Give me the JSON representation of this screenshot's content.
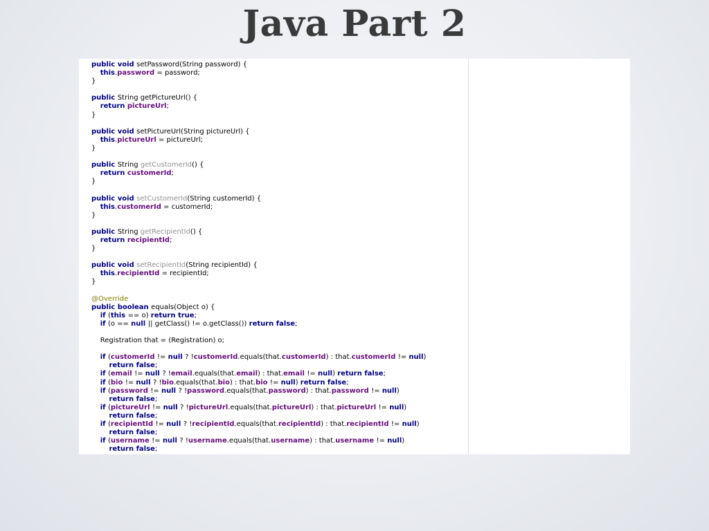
{
  "slide": {
    "title": "Java Part 2"
  },
  "code": {
    "lines": [
      [
        [
          "kw",
          "public void "
        ],
        [
          "plain",
          "setPassword(String password) {"
        ]
      ],
      [
        [
          "plain",
          "    "
        ],
        [
          "kw",
          "this"
        ],
        [
          "plain",
          "."
        ],
        [
          "fld",
          "password"
        ],
        [
          "plain",
          " = password;"
        ]
      ],
      [
        [
          "plain",
          "}"
        ]
      ],
      [],
      [
        [
          "kw",
          "public "
        ],
        [
          "plain",
          "String getPictureUrl() {"
        ]
      ],
      [
        [
          "plain",
          "    "
        ],
        [
          "kw",
          "return "
        ],
        [
          "fld",
          "pictureUrl"
        ],
        [
          "plain",
          ";"
        ]
      ],
      [
        [
          "plain",
          "}"
        ]
      ],
      [],
      [
        [
          "kw",
          "public void "
        ],
        [
          "plain",
          "setPictureUrl(String pictureUrl) {"
        ]
      ],
      [
        [
          "plain",
          "    "
        ],
        [
          "kw",
          "this"
        ],
        [
          "plain",
          "."
        ],
        [
          "fld",
          "pictureUrl"
        ],
        [
          "plain",
          " = pictureUrl;"
        ]
      ],
      [
        [
          "plain",
          "}"
        ]
      ],
      [],
      [
        [
          "kw",
          "public "
        ],
        [
          "plain",
          "String "
        ],
        [
          "unused",
          "getCustomerId"
        ],
        [
          "plain",
          "() {"
        ]
      ],
      [
        [
          "plain",
          "    "
        ],
        [
          "kw",
          "return "
        ],
        [
          "fld",
          "customerId"
        ],
        [
          "plain",
          ";"
        ]
      ],
      [
        [
          "plain",
          "}"
        ]
      ],
      [],
      [
        [
          "kw",
          "public void "
        ],
        [
          "unused",
          "setCustomerId"
        ],
        [
          "plain",
          "(String customerId) {"
        ]
      ],
      [
        [
          "plain",
          "    "
        ],
        [
          "kw",
          "this"
        ],
        [
          "plain",
          "."
        ],
        [
          "fld",
          "customerId"
        ],
        [
          "plain",
          " = customerId;"
        ]
      ],
      [
        [
          "plain",
          "}"
        ]
      ],
      [],
      [
        [
          "kw",
          "public "
        ],
        [
          "plain",
          "String "
        ],
        [
          "unused",
          "getRecipientId"
        ],
        [
          "plain",
          "() {"
        ]
      ],
      [
        [
          "plain",
          "    "
        ],
        [
          "kw",
          "return "
        ],
        [
          "fld",
          "recipientId"
        ],
        [
          "plain",
          ";"
        ]
      ],
      [
        [
          "plain",
          "}"
        ]
      ],
      [],
      [
        [
          "kw",
          "public void "
        ],
        [
          "unused",
          "setRecipientId"
        ],
        [
          "plain",
          "(String recipientId) {"
        ]
      ],
      [
        [
          "plain",
          "    "
        ],
        [
          "kw",
          "this"
        ],
        [
          "plain",
          "."
        ],
        [
          "fld",
          "recipientId"
        ],
        [
          "plain",
          " = recipientId;"
        ]
      ],
      [
        [
          "plain",
          "}"
        ]
      ],
      [],
      [
        [
          "ann",
          "@Override"
        ]
      ],
      [
        [
          "kw",
          "public boolean "
        ],
        [
          "plain",
          "equals(Object o) {"
        ]
      ],
      [
        [
          "plain",
          "    "
        ],
        [
          "kw",
          "if "
        ],
        [
          "plain",
          "("
        ],
        [
          "kw",
          "this "
        ],
        [
          "plain",
          "== o) "
        ],
        [
          "kw",
          "return true"
        ],
        [
          "plain",
          ";"
        ]
      ],
      [
        [
          "plain",
          "    "
        ],
        [
          "kw",
          "if "
        ],
        [
          "plain",
          "(o == "
        ],
        [
          "kw",
          "null "
        ],
        [
          "plain",
          "|| getClass() != o.getClass()) "
        ],
        [
          "kw",
          "return false"
        ],
        [
          "plain",
          ";"
        ]
      ],
      [],
      [
        [
          "plain",
          "    Registration that = (Registration) o;"
        ]
      ],
      [],
      [
        [
          "plain",
          "    "
        ],
        [
          "kw",
          "if "
        ],
        [
          "plain",
          "("
        ],
        [
          "fld",
          "customerId "
        ],
        [
          "plain",
          "!= "
        ],
        [
          "kw",
          "null "
        ],
        [
          "plain",
          "? !"
        ],
        [
          "fld",
          "customerId"
        ],
        [
          "plain",
          ".equals(that."
        ],
        [
          "fld",
          "customerId"
        ],
        [
          "plain",
          ") : that."
        ],
        [
          "fld",
          "customerId "
        ],
        [
          "plain",
          "!= "
        ],
        [
          "kw",
          "null"
        ],
        [
          "plain",
          ")"
        ]
      ],
      [
        [
          "plain",
          "        "
        ],
        [
          "kw",
          "return false"
        ],
        [
          "plain",
          ";"
        ]
      ],
      [
        [
          "plain",
          "    "
        ],
        [
          "kw",
          "if "
        ],
        [
          "plain",
          "("
        ],
        [
          "fld",
          "email "
        ],
        [
          "plain",
          "!= "
        ],
        [
          "kw",
          "null "
        ],
        [
          "plain",
          "? !"
        ],
        [
          "fld",
          "email"
        ],
        [
          "plain",
          ".equals(that."
        ],
        [
          "fld",
          "email"
        ],
        [
          "plain",
          ") : that."
        ],
        [
          "fld",
          "email "
        ],
        [
          "plain",
          "!= "
        ],
        [
          "kw",
          "null"
        ],
        [
          "plain",
          ") "
        ],
        [
          "kw",
          "return false"
        ],
        [
          "plain",
          ";"
        ]
      ],
      [
        [
          "plain",
          "    "
        ],
        [
          "kw",
          "if "
        ],
        [
          "plain",
          "("
        ],
        [
          "fld",
          "bio "
        ],
        [
          "plain",
          "!= "
        ],
        [
          "kw",
          "null "
        ],
        [
          "plain",
          "? !"
        ],
        [
          "fld",
          "bio"
        ],
        [
          "plain",
          ".equals(that."
        ],
        [
          "fld",
          "bio"
        ],
        [
          "plain",
          ") : that."
        ],
        [
          "fld",
          "bio "
        ],
        [
          "plain",
          "!= "
        ],
        [
          "kw",
          "null"
        ],
        [
          "plain",
          ") "
        ],
        [
          "kw",
          "return false"
        ],
        [
          "plain",
          ";"
        ]
      ],
      [
        [
          "plain",
          "    "
        ],
        [
          "kw",
          "if "
        ],
        [
          "plain",
          "("
        ],
        [
          "fld",
          "password "
        ],
        [
          "plain",
          "!= "
        ],
        [
          "kw",
          "null "
        ],
        [
          "plain",
          "? !"
        ],
        [
          "fld",
          "password"
        ],
        [
          "plain",
          ".equals(that."
        ],
        [
          "fld",
          "password"
        ],
        [
          "plain",
          ") : that."
        ],
        [
          "fld",
          "password "
        ],
        [
          "plain",
          "!= "
        ],
        [
          "kw",
          "null"
        ],
        [
          "plain",
          ")"
        ]
      ],
      [
        [
          "plain",
          "        "
        ],
        [
          "kw",
          "return false"
        ],
        [
          "plain",
          ";"
        ]
      ],
      [
        [
          "plain",
          "    "
        ],
        [
          "kw",
          "if "
        ],
        [
          "plain",
          "("
        ],
        [
          "fld",
          "pictureUrl "
        ],
        [
          "plain",
          "!= "
        ],
        [
          "kw",
          "null "
        ],
        [
          "plain",
          "? !"
        ],
        [
          "fld",
          "pictureUrl"
        ],
        [
          "plain",
          ".equals(that."
        ],
        [
          "fld",
          "pictureUrl"
        ],
        [
          "plain",
          ") : that."
        ],
        [
          "fld",
          "pictureUrl "
        ],
        [
          "plain",
          "!= "
        ],
        [
          "kw",
          "null"
        ],
        [
          "plain",
          ")"
        ]
      ],
      [
        [
          "plain",
          "        "
        ],
        [
          "kw",
          "return false"
        ],
        [
          "plain",
          ";"
        ]
      ],
      [
        [
          "plain",
          "    "
        ],
        [
          "kw",
          "if "
        ],
        [
          "plain",
          "("
        ],
        [
          "fld",
          "recipientId "
        ],
        [
          "plain",
          "!= "
        ],
        [
          "kw",
          "null "
        ],
        [
          "plain",
          "? !"
        ],
        [
          "fld",
          "recipientId"
        ],
        [
          "plain",
          ".equals(that."
        ],
        [
          "fld",
          "recipientId"
        ],
        [
          "plain",
          ") : that."
        ],
        [
          "fld",
          "recipientId "
        ],
        [
          "plain",
          "!= "
        ],
        [
          "kw",
          "null"
        ],
        [
          "plain",
          ")"
        ]
      ],
      [
        [
          "plain",
          "        "
        ],
        [
          "kw",
          "return false"
        ],
        [
          "plain",
          ";"
        ]
      ],
      [
        [
          "plain",
          "    "
        ],
        [
          "kw",
          "if "
        ],
        [
          "plain",
          "("
        ],
        [
          "fld",
          "username "
        ],
        [
          "plain",
          "!= "
        ],
        [
          "kw",
          "null "
        ],
        [
          "plain",
          "? !"
        ],
        [
          "fld",
          "username"
        ],
        [
          "plain",
          ".equals(that."
        ],
        [
          "fld",
          "username"
        ],
        [
          "plain",
          ") : that."
        ],
        [
          "fld",
          "username "
        ],
        [
          "plain",
          "!= "
        ],
        [
          "kw",
          "null"
        ],
        [
          "plain",
          ")"
        ]
      ],
      [
        [
          "plain",
          "        "
        ],
        [
          "kw",
          "return false"
        ],
        [
          "plain",
          ";"
        ]
      ]
    ]
  },
  "colors": {
    "keyword": "#000080",
    "field": "#660e7a",
    "unused_method": "#909090",
    "annotation": "#808000",
    "title": "#3a3a3a"
  }
}
